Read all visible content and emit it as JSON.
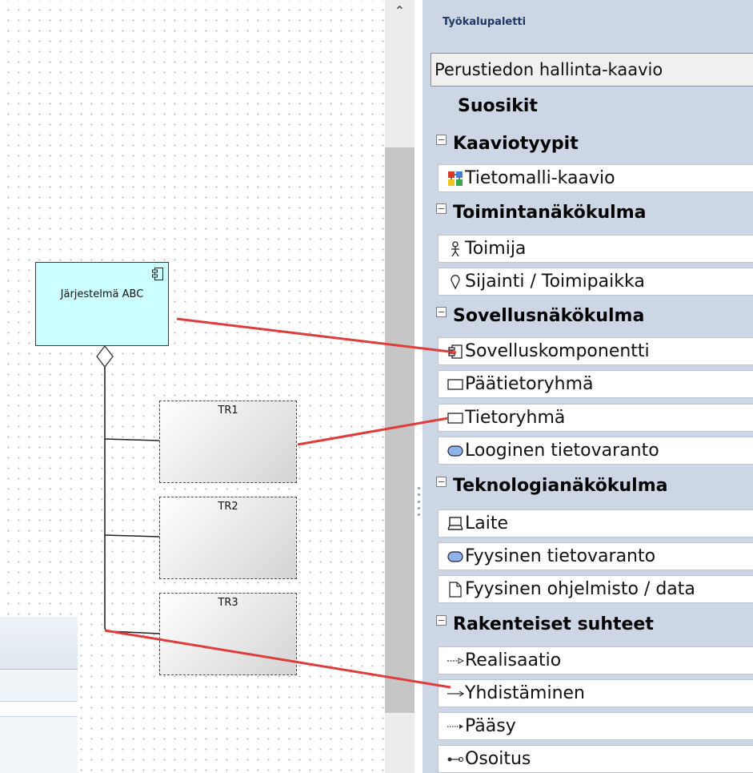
{
  "diagram": {
    "system_element": "Järjestelmä ABC",
    "data_groups": [
      "TR1",
      "TR2",
      "TR3"
    ]
  },
  "toolbox": {
    "title": "Työkalupaletti",
    "dropdown_value": "Perustiedon hallinta-kaavio",
    "favorites": "Suosikit",
    "groups": [
      {
        "label": "Kaaviotyypit",
        "items": [
          {
            "label": "Tietomalli-kaavio",
            "icon": "diagram-icon"
          }
        ]
      },
      {
        "label": "Toimintanäkökulma",
        "items": [
          {
            "label": "Toimija",
            "icon": "actor-icon"
          },
          {
            "label": "Sijainti / Toimipaikka",
            "icon": "location-icon"
          }
        ]
      },
      {
        "label": "Sovellusnäkökulma",
        "items": [
          {
            "label": "Sovelluskomponentti",
            "icon": "component-icon"
          },
          {
            "label": "Päätietoryhmä",
            "icon": "rectangle-icon"
          },
          {
            "label": "Tietoryhmä",
            "icon": "rectangle-icon"
          },
          {
            "label": "Looginen tietovaranto",
            "icon": "datastore-icon"
          }
        ]
      },
      {
        "label": "Teknologianäkökulma",
        "items": [
          {
            "label": "Laite",
            "icon": "device-icon"
          },
          {
            "label": "Fyysinen tietovaranto",
            "icon": "datastore-icon"
          },
          {
            "label": "Fyysinen ohjelmisto / data",
            "icon": "document-icon"
          }
        ]
      },
      {
        "label": "Rakenteiset suhteet",
        "items": [
          {
            "label": "Realisaatio",
            "icon": "realization-arrow-icon"
          },
          {
            "label": "Yhdistäminen",
            "icon": "association-arrow-icon"
          },
          {
            "label": "Pääsy",
            "icon": "access-arrow-icon"
          },
          {
            "label": "Osoitus",
            "icon": "assignment-arrow-icon"
          }
        ]
      }
    ]
  },
  "colors": {
    "annotation_line": "#e03c3c",
    "system_fill": "#ccffff",
    "toolbox_bg": "#ccd6e4"
  }
}
